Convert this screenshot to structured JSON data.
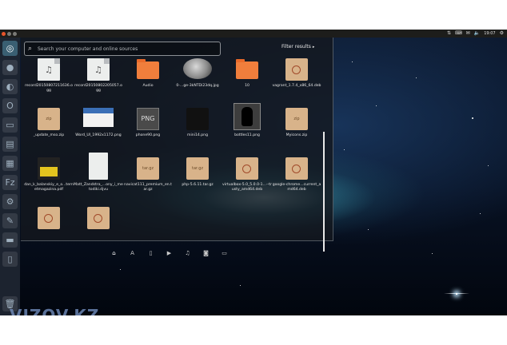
{
  "topbar": {
    "time": "19:07",
    "tray_icons": [
      "network-icon",
      "keyboard-icon",
      "mail-icon",
      "volume-icon",
      "clock"
    ]
  },
  "search": {
    "placeholder": "Search your computer and online sources",
    "value": ""
  },
  "filter": {
    "label": "Filter results"
  },
  "files": [
    {
      "label": "record20150807211636.ogg",
      "kind": "audio"
    },
    {
      "label": "record20150802205057.ogg",
      "kind": "audio"
    },
    {
      "label": "Audio",
      "kind": "folder"
    },
    {
      "label": "0-...ge-3kNTDi23dq.jpg",
      "kind": "image-moon"
    },
    {
      "label": "10",
      "kind": "folder"
    },
    {
      "label": "vagrant_1.7.4_x86_64.deb",
      "kind": "deb"
    },
    {
      "label": "_update_mso.zip",
      "kind": "zip"
    },
    {
      "label": "Word_UI_1992x1172.png",
      "kind": "image-screenshot"
    },
    {
      "label": "phone90.png",
      "kind": "image-png"
    },
    {
      "label": "mini14.png",
      "kind": "image-dark"
    },
    {
      "label": "bottles11.png",
      "kind": "image-bottle"
    },
    {
      "label": "Myicons.zip",
      "kind": "zip"
    },
    {
      "label": "dan_k_balanskiy_e_o...ternetmagazina.pdf",
      "kind": "pdf"
    },
    {
      "label": "Matt_Zandstra_...ony_i_metodiki.djvu",
      "kind": "doc"
    },
    {
      "label": "navicat111_premium_en.tar.gz",
      "kind": "targz"
    },
    {
      "label": "php-5.6.11.tar.gz",
      "kind": "targz"
    },
    {
      "label": "virtualbox-5.0_5.0.0-1...--trusty_amd64.deb",
      "kind": "deb"
    },
    {
      "label": "google-chrome...current_amd64.deb",
      "kind": "deb"
    },
    {
      "label": "",
      "kind": "deb"
    },
    {
      "label": "",
      "kind": "deb"
    }
  ],
  "lenses": [
    "home-icon",
    "apps-icon",
    "files-icon",
    "video-icon",
    "music-icon",
    "photos-icon",
    "social-icon"
  ],
  "watermark": "VIZOV.KZ"
}
